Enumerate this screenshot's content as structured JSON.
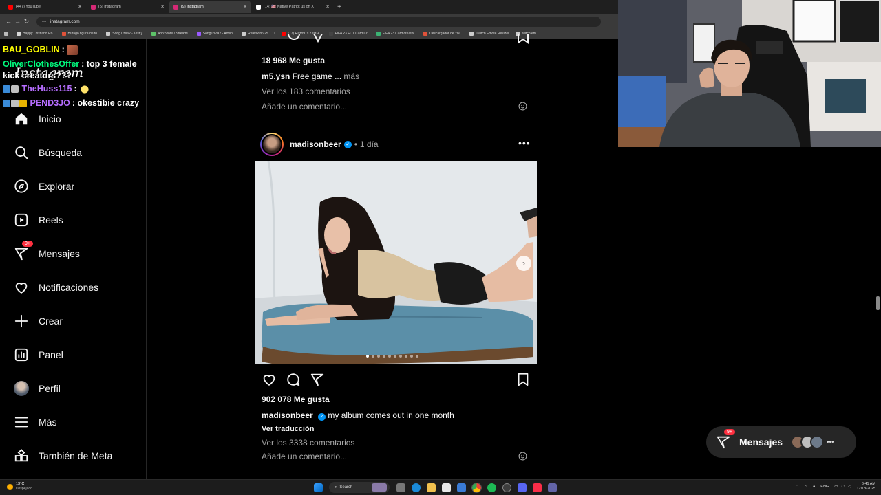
{
  "browser": {
    "tabs": [
      {
        "label": "(447) YouTube",
        "color": "#ff0000",
        "active": false
      },
      {
        "label": "(5) Instagram",
        "color": "#d62976",
        "active": false
      },
      {
        "label": "(9) Instagram",
        "color": "#d62976",
        "active": true
      },
      {
        "label": "(14) 🇺🇸 Native Patriot us on X",
        "color": "#ffffff",
        "active": false
      }
    ],
    "url": "instagram.com",
    "bookmarks": [
      {
        "label": "Happy Cristiano Ro...",
        "color": "#d6d6d6"
      },
      {
        "label": "Burago figura de to...",
        "color": "#e0523a"
      },
      {
        "label": "SongTrivia2 - Test y...",
        "color": "#cccccc"
      },
      {
        "label": "App Store / Streami...",
        "color": "#5ec269"
      },
      {
        "label": "SongTrivia2 - Advin...",
        "color": "#9b59ff"
      },
      {
        "label": "Reletoob v25.1.11",
        "color": "#cccccc"
      },
      {
        "label": "(77) Razo97s Zest-A...",
        "color": "#ff0000"
      },
      {
        "label": "FIFA 23 FUT Card Cr...",
        "color": "#444444"
      },
      {
        "label": "FIFA 23 Card creator...",
        "color": "#3bb273"
      },
      {
        "label": "Descargador de You...",
        "color": "#e0523a"
      },
      {
        "label": "Twitch Emote Resizer",
        "color": "#cccccc"
      },
      {
        "label": "twitch em",
        "color": "#cccccc"
      }
    ]
  },
  "sidebar": {
    "logo": "Instagram",
    "items": [
      {
        "label": "Inicio",
        "icon": "home-icon"
      },
      {
        "label": "Búsqueda",
        "icon": "search-icon"
      },
      {
        "label": "Explorar",
        "icon": "compass-icon"
      },
      {
        "label": "Reels",
        "icon": "reels-icon"
      },
      {
        "label": "Mensajes",
        "icon": "messenger-icon",
        "badge": "9+"
      },
      {
        "label": "Notificaciones",
        "icon": "heart-icon"
      },
      {
        "label": "Crear",
        "icon": "plus-icon"
      },
      {
        "label": "Panel",
        "icon": "dashboard-icon"
      },
      {
        "label": "Perfil",
        "icon": "profile-avatar"
      },
      {
        "label": "Más",
        "icon": "menu-icon"
      },
      {
        "label": "También de Meta",
        "icon": "meta-apps-icon"
      }
    ]
  },
  "previous_post": {
    "likes": "18 968 Me gusta",
    "caption_user": "m5.ysn",
    "caption_text": "Free game ...",
    "more": "más",
    "comments": "Ver los 183 comentarios",
    "add_comment": "Añade un comentario..."
  },
  "post": {
    "username": "madisonbeer",
    "time": "1 día",
    "likes": "902 078 Me gusta",
    "caption_user": "madisonbeer",
    "caption_text": "my album comes out in one month",
    "translate": "Ver traducción",
    "comments": "Ver los 3338 comentarios",
    "add_comment": "Añade un comentario...",
    "carousel_count": 10,
    "carousel_index": 1
  },
  "chat": [
    {
      "user": "BAU_GOBLIN",
      "color": "#ffff00",
      "text": ":",
      "emote": true
    },
    {
      "user": "OliverClothesOffer",
      "color": "#00ff7f",
      "text": ": top 3 female kick creators???"
    },
    {
      "user": "TheHuss115",
      "color": "#b66dff",
      "text": ":",
      "emote": true
    },
    {
      "user": "PEND3JO",
      "color": "#b66dff",
      "text": ": okestibie crazy"
    }
  ],
  "messages_pill": {
    "label": "Mensajes",
    "badge": "9+"
  },
  "taskbar": {
    "weather_temp": "13°C",
    "weather_desc": "Despejado",
    "search": "Search",
    "lang": "ENG",
    "time": "6:41 AM",
    "date": "12/18/2025"
  }
}
